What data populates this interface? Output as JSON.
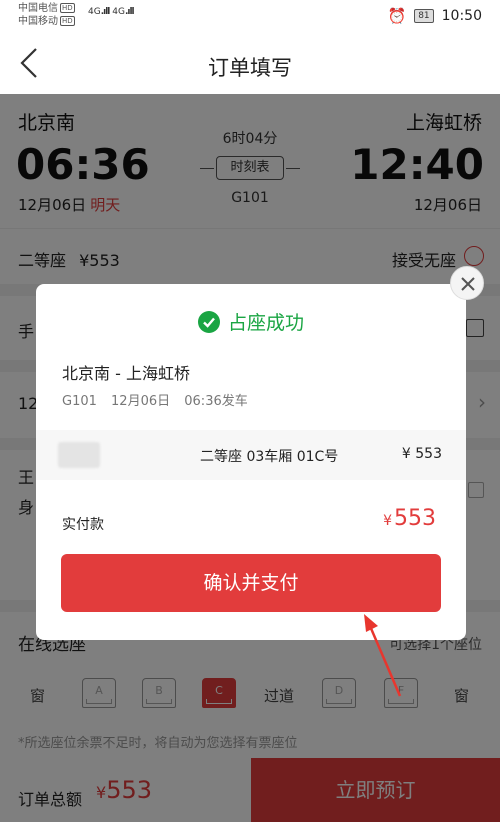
{
  "status_bar": {
    "carrier_1": "中国电信",
    "carrier_2": "中国移动",
    "hd_badge": "HD",
    "network_1": "4G",
    "network_2": "4G",
    "battery": "81",
    "time": "10:50",
    "alarm_icon": "alarm-clock-icon"
  },
  "nav": {
    "title": "订单填写",
    "back_icon": "chevron-left-icon"
  },
  "train": {
    "from_station": "北京南",
    "to_station": "上海虹桥",
    "depart_time": "06:36",
    "arrive_time": "12:40",
    "depart_date": "12月06日",
    "depart_day_note": "明天",
    "arrive_date": "12月06日",
    "duration": "6时04分",
    "timetable_label": "时刻表",
    "train_number": "G101"
  },
  "seat_row": {
    "seat_class": "二等座",
    "price": "¥553",
    "no_seat_label": "接受无座"
  },
  "rows_partial": {
    "row_a": "手",
    "row_b": "12",
    "row_c_line1": "王",
    "row_c_line2": "身"
  },
  "seat_select": {
    "title": "在线选座",
    "hint": "可选择1个座位",
    "window_left": "窗",
    "aisle": "过道",
    "window_right": "窗",
    "seats": [
      "A",
      "B",
      "C",
      "D",
      "F"
    ],
    "selected_seat": "C",
    "note": "*所选座位余票不足时，将自动为您选择有票座位"
  },
  "bottom": {
    "total_label": "订单总额",
    "currency": "¥",
    "total_amount": "553",
    "book_button": "立即预订"
  },
  "modal": {
    "success_text": "占座成功",
    "route": "北京南 - 上海虹桥",
    "trip_train": "G101",
    "trip_date": "12月06日",
    "trip_time": "06:36发车",
    "seat_info": "二等座 03车厢 01C号",
    "seat_price": "¥ 553",
    "pay_label": "实付款",
    "pay_currency": "¥",
    "pay_amount": "553",
    "confirm_button": "确认并支付"
  },
  "colors": {
    "accent_red": "#e23c3c",
    "success_green": "#1aa543"
  }
}
